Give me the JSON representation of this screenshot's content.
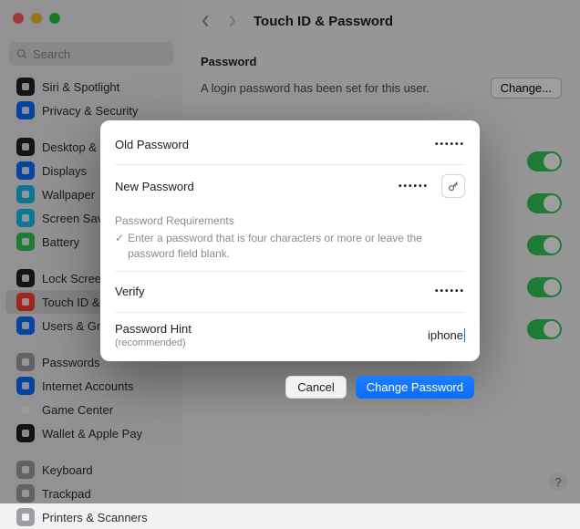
{
  "window": {
    "title": "Touch ID & Password"
  },
  "search": {
    "placeholder": "Search"
  },
  "sidebar": {
    "groups": [
      [
        {
          "label": "Siri & Spotlight",
          "icon": "siri",
          "bg": "#1f1f1f"
        },
        {
          "label": "Privacy & Security",
          "icon": "hand",
          "bg": "#0a6cff"
        }
      ],
      [
        {
          "label": "Desktop & Dock",
          "icon": "desktop",
          "bg": "#1f1f1f"
        },
        {
          "label": "Displays",
          "icon": "displays",
          "bg": "#0a6cff"
        },
        {
          "label": "Wallpaper",
          "icon": "wallpaper",
          "bg": "#18bdec"
        },
        {
          "label": "Screen Saver",
          "icon": "screensaver",
          "bg": "#18bdec"
        },
        {
          "label": "Battery",
          "icon": "battery",
          "bg": "#34c759"
        }
      ],
      [
        {
          "label": "Lock Screen",
          "icon": "lock",
          "bg": "#1f1f1f"
        },
        {
          "label": "Touch ID & Password",
          "icon": "touchid",
          "bg": "#ff3b30",
          "active": true
        },
        {
          "label": "Users & Groups",
          "icon": "users",
          "bg": "#0a6cff"
        }
      ],
      [
        {
          "label": "Passwords",
          "icon": "key",
          "bg": "#9e9ea3"
        },
        {
          "label": "Internet Accounts",
          "icon": "at",
          "bg": "#0a6cff"
        },
        {
          "label": "Game Center",
          "icon": "game",
          "bg": "#ececee"
        },
        {
          "label": "Wallet & Apple Pay",
          "icon": "wallet",
          "bg": "#1f1f1f"
        }
      ],
      [
        {
          "label": "Keyboard",
          "icon": "keyboard",
          "bg": "#9e9ea3"
        },
        {
          "label": "Trackpad",
          "icon": "trackpad",
          "bg": "#9e9ea3"
        },
        {
          "label": "Printers & Scanners",
          "icon": "printer",
          "bg": "#9e9ea3"
        }
      ]
    ]
  },
  "main": {
    "section": "Password",
    "desc": "A login password has been set for this user.",
    "change_btn": "Change..."
  },
  "modal": {
    "old_label": "Old Password",
    "old_value": "••••••",
    "new_label": "New Password",
    "new_value": "••••••",
    "req_title": "Password Requirements",
    "req_check": "✓",
    "req_text": "Enter a password that is four characters or more or leave the password field blank.",
    "verify_label": "Verify",
    "verify_value": "••••••",
    "hint_label": "Password Hint",
    "hint_sub": "(recommended)",
    "hint_value": "iphone",
    "cancel": "Cancel",
    "confirm": "Change Password"
  },
  "help": "?"
}
